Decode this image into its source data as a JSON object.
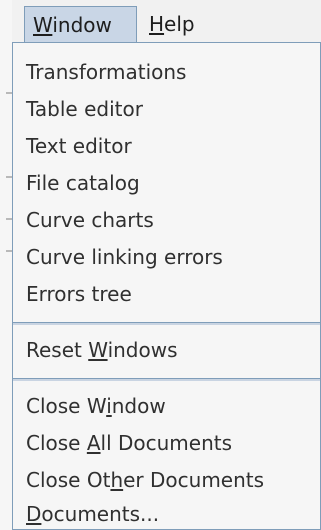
{
  "menubar": {
    "window": {
      "pre": "",
      "mn": "W",
      "post": "indow"
    },
    "help": {
      "pre": "",
      "mn": "H",
      "post": "elp"
    }
  },
  "window_menu": {
    "group1": [
      {
        "pre": "Transformations",
        "mn": "",
        "post": ""
      },
      {
        "pre": "Table editor",
        "mn": "",
        "post": ""
      },
      {
        "pre": "Text editor",
        "mn": "",
        "post": ""
      },
      {
        "pre": "File catalog",
        "mn": "",
        "post": ""
      },
      {
        "pre": "Curve charts",
        "mn": "",
        "post": ""
      },
      {
        "pre": "Curve linking errors",
        "mn": "",
        "post": ""
      },
      {
        "pre": "Errors tree",
        "mn": "",
        "post": ""
      }
    ],
    "reset": {
      "pre": "Reset ",
      "mn": "W",
      "post": "indows"
    },
    "group3": [
      {
        "pre": "Close W",
        "mn": "i",
        "post": "ndow"
      },
      {
        "pre": "Close ",
        "mn": "A",
        "post": "ll Documents"
      },
      {
        "pre": "Close Ot",
        "mn": "h",
        "post": "er Documents"
      },
      {
        "pre": "",
        "mn": "D",
        "post": "ocuments..."
      }
    ]
  },
  "colors": {
    "menu_bg": "#f6f6f6",
    "highlight": "#c9d6e6",
    "border": "#7f9db9"
  }
}
